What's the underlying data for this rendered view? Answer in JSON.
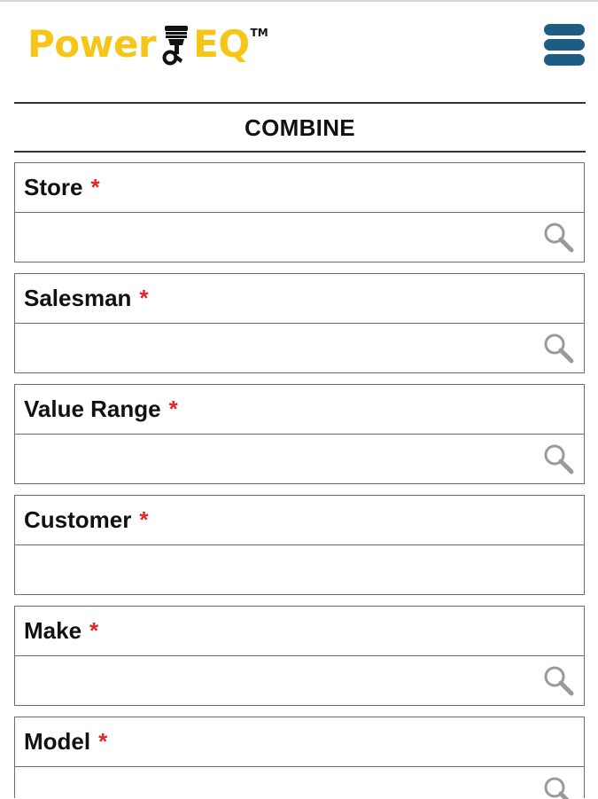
{
  "header": {
    "brand_part1": "Power",
    "brand_part2": "EQ",
    "trademark": "TM",
    "brand_color": "#F5C518",
    "menu_icon": "hamburger-menu-icon",
    "menu_color": "#1E5C84"
  },
  "page": {
    "title": "COMBINE"
  },
  "form": {
    "required_marker": "*",
    "required_color": "#E0262B",
    "fields": [
      {
        "label": "Store",
        "value": "",
        "has_search": true
      },
      {
        "label": "Salesman",
        "value": "",
        "has_search": true
      },
      {
        "label": "Value Range",
        "value": "",
        "has_search": true
      },
      {
        "label": "Customer",
        "value": "",
        "has_search": false
      },
      {
        "label": "Make",
        "value": "",
        "has_search": true
      },
      {
        "label": "Model",
        "value": "",
        "has_search": true
      }
    ]
  }
}
